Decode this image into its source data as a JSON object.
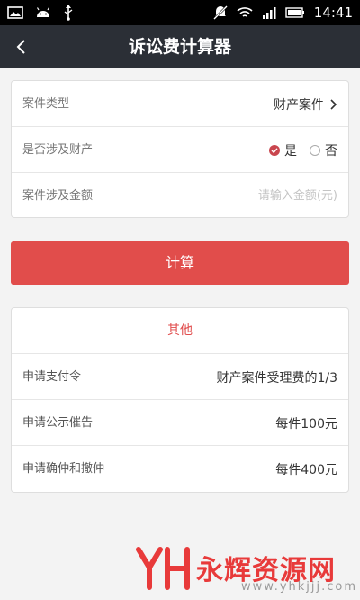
{
  "status_bar": {
    "time": "14:41",
    "icons": [
      "image-icon",
      "android-icon",
      "usb-icon",
      "mute-icon",
      "wifi-icon",
      "signal-icon",
      "battery-icon"
    ]
  },
  "header": {
    "title": "诉讼费计算器",
    "back_icon": "chevron-left-icon"
  },
  "form": {
    "case_type": {
      "label": "案件类型",
      "value": "财产案件"
    },
    "involves_property": {
      "label": "是否涉及财产",
      "yes": "是",
      "no": "否",
      "selected": "是"
    },
    "amount": {
      "label": "案件涉及金额",
      "placeholder": "请输入金额(元)",
      "value": ""
    }
  },
  "calculate_button": {
    "label": "计算"
  },
  "other": {
    "title": "其他",
    "rows": [
      {
        "label": "申请支付令",
        "value": "财产案件受理费的1/3"
      },
      {
        "label": "申请公示催告",
        "value": "每件100元"
      },
      {
        "label": "申请确仲和撤仲",
        "value": "每件400元"
      }
    ]
  },
  "watermark": {
    "logo_text": "YH",
    "brand": "永辉资源网",
    "url": "www.yhkjjj.com"
  },
  "colors": {
    "header_bg": "#2b2f36",
    "accent_red": "#e14d4b",
    "background": "#f3f3f3"
  }
}
